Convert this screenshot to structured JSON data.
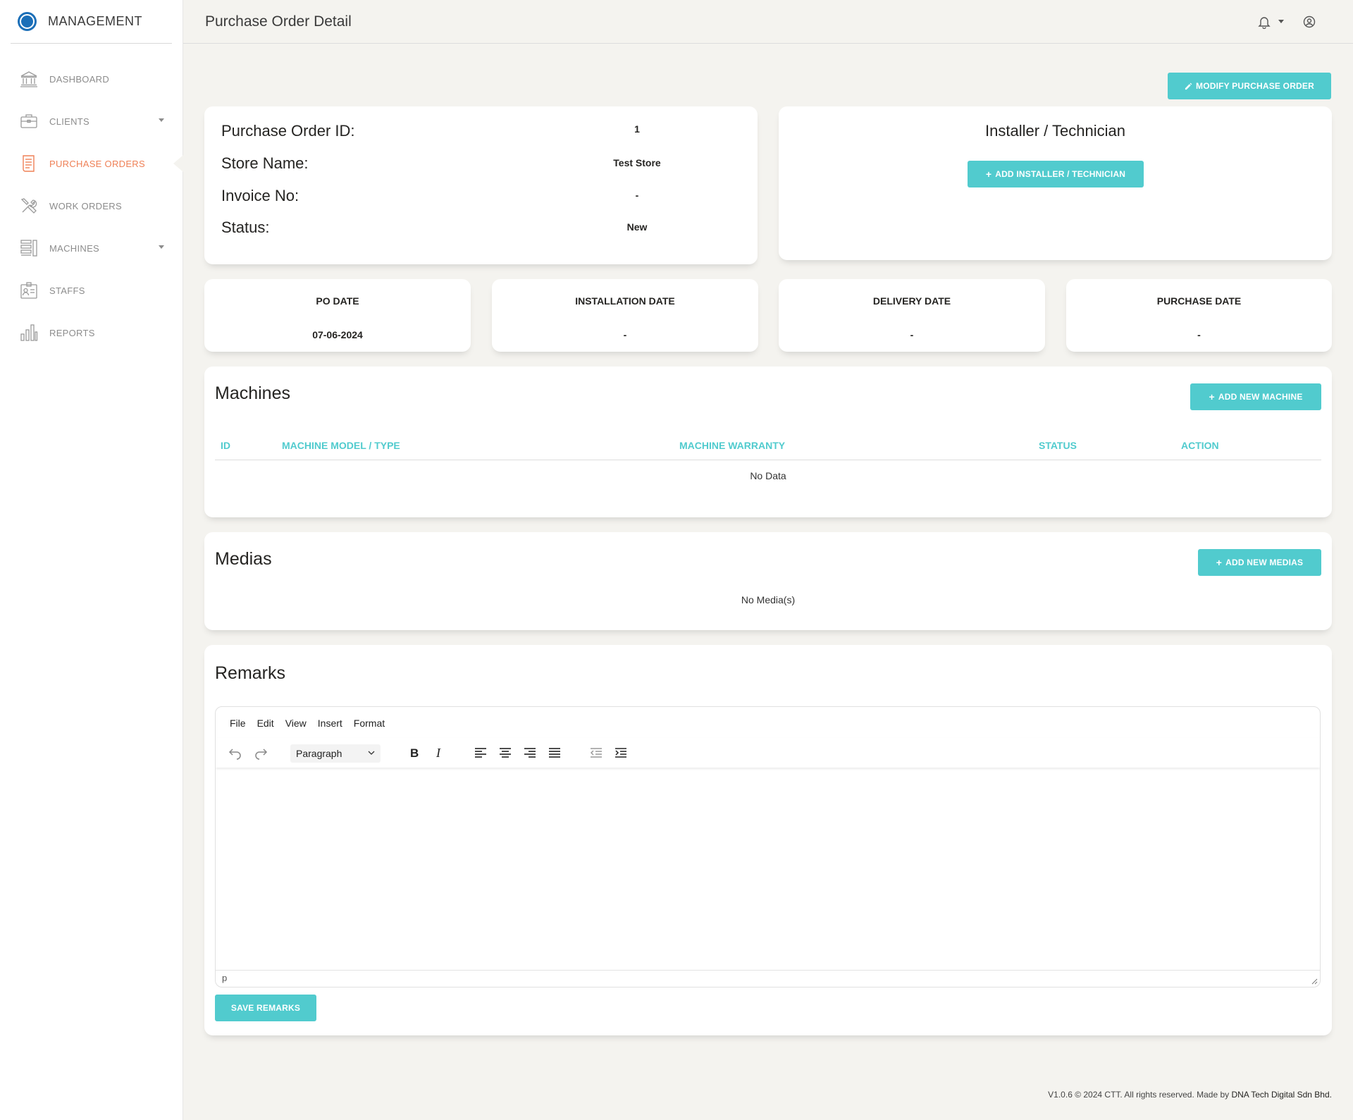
{
  "brand": {
    "name": "MANAGEMENT"
  },
  "sidebar": {
    "items": [
      {
        "label": "DASHBOARD",
        "icon": "bank-icon"
      },
      {
        "label": "CLIENTS",
        "icon": "briefcase-icon"
      },
      {
        "label": "PURCHASE ORDERS",
        "icon": "document-icon"
      },
      {
        "label": "WORK ORDERS",
        "icon": "tools-icon"
      },
      {
        "label": "MACHINES",
        "icon": "server-icon"
      },
      {
        "label": "STAFFS",
        "icon": "badge-icon"
      },
      {
        "label": "REPORTS",
        "icon": "bar-chart-icon"
      }
    ]
  },
  "header": {
    "title": "Purchase Order Detail"
  },
  "actions": {
    "modify_label": "MODIFY PURCHASE ORDER"
  },
  "po": {
    "id_label": "Purchase Order ID:",
    "id_value": "1",
    "store_label": "Store Name:",
    "store_value": "Test Store",
    "invoice_label": "Invoice No:",
    "invoice_value": "-",
    "status_label": "Status:",
    "status_value": "New"
  },
  "installer": {
    "title": "Installer / Technician",
    "add_label": "ADD INSTALLER / TECHNICIAN"
  },
  "dates": [
    {
      "title": "PO DATE",
      "value": "07-06-2024"
    },
    {
      "title": "INSTALLATION DATE",
      "value": "-"
    },
    {
      "title": "DELIVERY DATE",
      "value": "-"
    },
    {
      "title": "PURCHASE DATE",
      "value": "-"
    }
  ],
  "machines": {
    "title": "Machines",
    "add_label": "ADD NEW MACHINE",
    "columns": [
      "ID",
      "MACHINE MODEL / TYPE",
      "MACHINE WARRANTY",
      "STATUS",
      "ACTION"
    ],
    "empty": "No Data"
  },
  "medias": {
    "title": "Medias",
    "add_label": "ADD NEW MEDIAS",
    "empty": "No Media(s)"
  },
  "remarks": {
    "title": "Remarks",
    "menu": [
      "File",
      "Edit",
      "View",
      "Insert",
      "Format"
    ],
    "block_format": "Paragraph",
    "status_path": "p",
    "save_label": "SAVE REMARKS"
  },
  "footer": {
    "text": "V1.0.6 © 2024 CTT. All rights reserved. Made by ",
    "maker": "DNA Tech Digital Sdn Bhd."
  },
  "colors": {
    "accent": "#51cbce",
    "active": "#ef8157",
    "background": "#f4f3ef"
  }
}
